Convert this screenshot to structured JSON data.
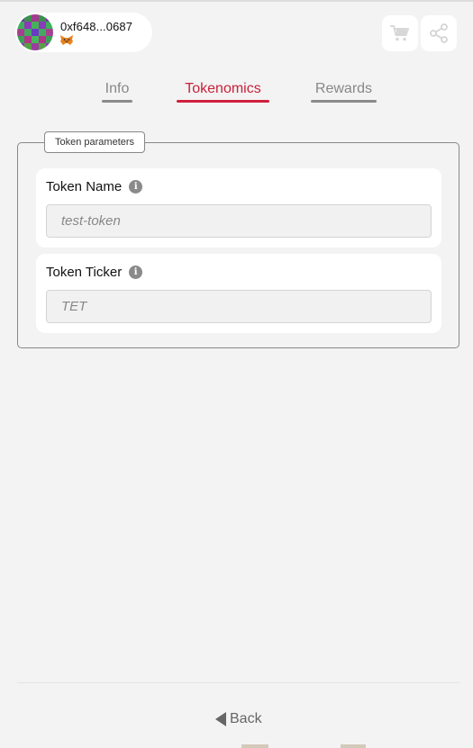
{
  "account": {
    "address": "0xf648...0687",
    "wallet_icon": "metamask-fox-icon"
  },
  "actions": {
    "cart_icon": "cart-icon",
    "share_icon": "share-icon"
  },
  "tabs": [
    {
      "label": "Info",
      "active": false
    },
    {
      "label": "Tokenomics",
      "active": true
    },
    {
      "label": "Rewards",
      "active": false
    }
  ],
  "section": {
    "legend": "Token parameters",
    "fields": [
      {
        "label": "Token Name",
        "placeholder": "test-token",
        "value": ""
      },
      {
        "label": "Token Ticker",
        "placeholder": "TET",
        "value": ""
      }
    ]
  },
  "footer": {
    "back_label": "Back"
  },
  "colors": {
    "accent": "#d01f3c",
    "background": "#f3f3f3",
    "card": "#ffffff",
    "muted": "#888888"
  }
}
